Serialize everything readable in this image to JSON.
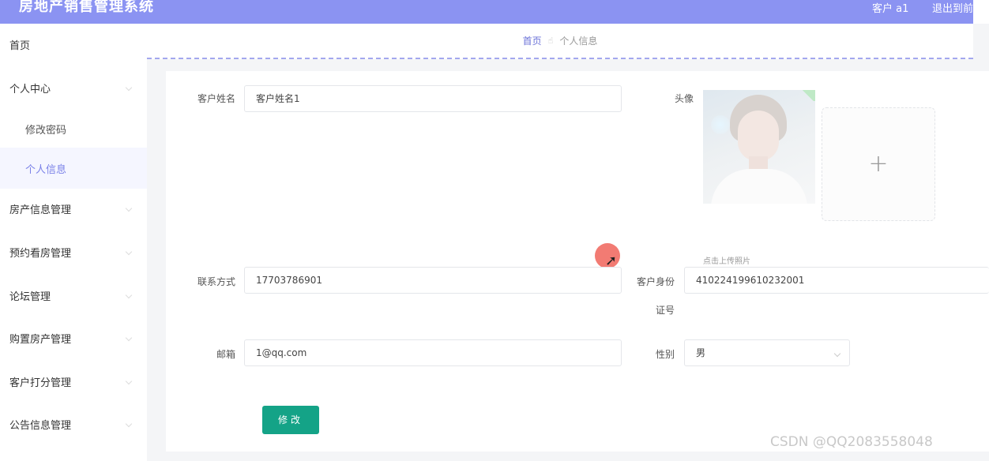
{
  "header": {
    "app_title": "房地产销售管理系统",
    "user_label": "客户 a1",
    "logout_label": "退出到前台"
  },
  "sidebar": {
    "items": [
      {
        "label": "首页"
      },
      {
        "label": "个人中心"
      },
      {
        "label": "修改密码"
      },
      {
        "label": "个人信息"
      },
      {
        "label": "房产信息管理"
      },
      {
        "label": "预约看房管理"
      },
      {
        "label": "论坛管理"
      },
      {
        "label": "购置房产管理"
      },
      {
        "label": "客户打分管理"
      },
      {
        "label": "公告信息管理"
      }
    ]
  },
  "breadcrumb": {
    "home": "首页",
    "separator": "☝",
    "current": "个人信息"
  },
  "form": {
    "name_label": "客户姓名",
    "name_value": "客户姓名1",
    "avatar_label": "头像",
    "upload_hint": "点击上传照片",
    "phone_label": "联系方式",
    "phone_value": "17703786901",
    "idcard_label_line1": "客户身份",
    "idcard_label_line2": "证号",
    "idcard_value": "410224199610232001",
    "email_label": "邮箱",
    "email_value": "1@qq.com",
    "gender_label": "性别",
    "gender_value": "男",
    "submit_label": "修改"
  },
  "watermark": "CSDN @QQ2083558048",
  "colors": {
    "header_bg": "#8b93f2",
    "active_menu": "#7b82e8",
    "submit_bg": "#14a387"
  }
}
